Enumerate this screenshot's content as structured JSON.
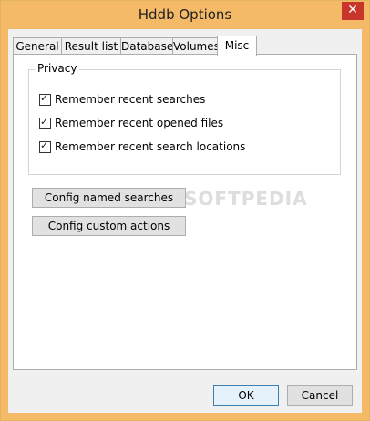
{
  "window": {
    "title": "Hddb Options",
    "close_glyph": "✕"
  },
  "tabs": [
    {
      "label": "General"
    },
    {
      "label": "Result list"
    },
    {
      "label": "Database"
    },
    {
      "label": "Volumes"
    },
    {
      "label": "Misc"
    }
  ],
  "active_tab": "Misc",
  "privacy": {
    "label": "Privacy",
    "options": [
      {
        "label": "Remember recent searches",
        "checked": true
      },
      {
        "label": "Remember recent opened files",
        "checked": true
      },
      {
        "label": "Remember recent search locations",
        "checked": true
      }
    ]
  },
  "buttons": {
    "config_named_searches": "Config named searches",
    "config_custom_actions": "Config custom actions",
    "ok": "OK",
    "cancel": "Cancel"
  },
  "watermark": "SOFTPEDIA",
  "colors": {
    "title_bar": "#f5ba68",
    "close_button": "#c8352b"
  }
}
